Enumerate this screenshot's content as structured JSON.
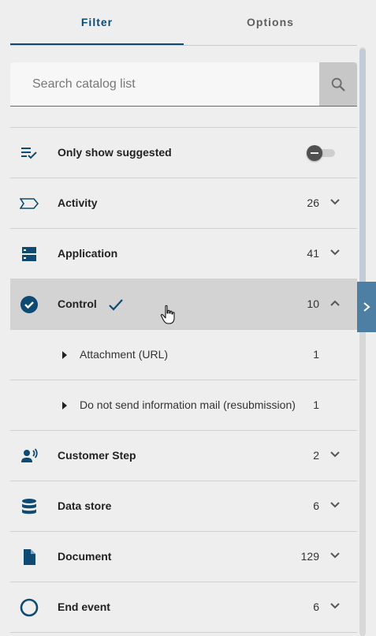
{
  "tabs": [
    {
      "label": "Filter",
      "active": true
    },
    {
      "label": "Options",
      "active": false
    }
  ],
  "search": {
    "placeholder": "Search catalog list"
  },
  "suggested": {
    "label": "Only show suggested"
  },
  "categories": [
    {
      "label": "Activity",
      "count": "26",
      "icon": "activity-icon"
    },
    {
      "label": "Application",
      "count": "41",
      "icon": "application-icon"
    },
    {
      "label": "Control",
      "count": "10",
      "icon": "control-check-circle-icon",
      "expanded": true,
      "selected": true
    }
  ],
  "control_children": [
    {
      "label": "Attachment (URL)",
      "count": "1"
    },
    {
      "label": "Do not send information mail (resubmission)",
      "count": "1"
    }
  ],
  "categories_after": [
    {
      "label": "Customer Step",
      "count": "2",
      "icon": "customer-step-icon"
    },
    {
      "label": "Data store",
      "count": "6",
      "icon": "data-store-icon"
    },
    {
      "label": "Document",
      "count": "129",
      "icon": "document-icon"
    },
    {
      "label": "End event",
      "count": "6",
      "icon": "end-event-icon"
    }
  ],
  "colors": {
    "accent": "#0e4a73",
    "side_toggle": "#4d7fa5"
  }
}
